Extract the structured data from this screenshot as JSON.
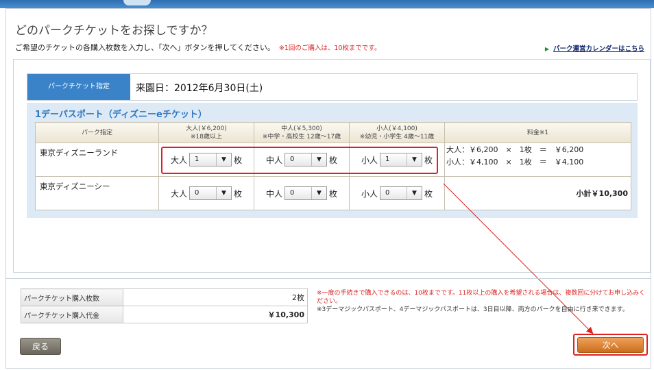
{
  "header": {
    "title": "どのパークチケットをお探しですか？",
    "instruction": "ご希望のチケットの各購入枚数を入力し、「次へ」ボタンを押してください。",
    "instruction_note": "※1回のご購入は、10枚までです。",
    "calendar_link": "パーク運営カレンダーはこちら"
  },
  "selection": {
    "label": "パークチケット指定",
    "date": "来園日：2012年6月30日(土)"
  },
  "pass": {
    "title": "1デーパスポート（ディズニーeチケット）",
    "columns": {
      "park": "パーク指定",
      "adult_line1": "大人(￥6,200)",
      "adult_line2": "※18歳以上",
      "junior_line1": "中人(￥5,300)",
      "junior_line2": "※中学・高校生 12歳～17歳",
      "child_line1": "小人(￥4,100)",
      "child_line2": "※幼児・小学生 4歳～11歳",
      "fee": "料金※1"
    },
    "labels": {
      "adult": "大人",
      "junior": "中人",
      "child": "小人",
      "unit": "枚"
    },
    "rows": [
      {
        "park": "東京ディズニーランド",
        "adult": "1",
        "junior": "0",
        "child": "1"
      },
      {
        "park": "東京ディズニーシー",
        "adult": "0",
        "junior": "0",
        "child": "0"
      }
    ],
    "fee_lines": [
      "大人：￥6,200　×　1枚　＝　￥6,200",
      "小人：￥4,100　×　1枚　＝　￥4,100"
    ],
    "subtotal": "小計￥10,300"
  },
  "summary": {
    "count_label": "パークチケット購入枚数",
    "count_value": "2枚",
    "price_label": "パークチケット購入代金",
    "price_value": "￥10,300",
    "note_red": "※一度の手続きで購入できるのは、10枚までです。11枚以上の購入を希望される場合は、複数回に分けてお申し込みください。",
    "note_gray": "※3デーマジックパスポート、4デーマジックパスポートは、3日目以降、両方のパークを自由に行き来できます。"
  },
  "buttons": {
    "back": "戻る",
    "next": "次へ"
  },
  "colors": {
    "accent_blue": "#3b83c9",
    "highlight_red": "#e02020",
    "next_orange": "#d9802e"
  }
}
